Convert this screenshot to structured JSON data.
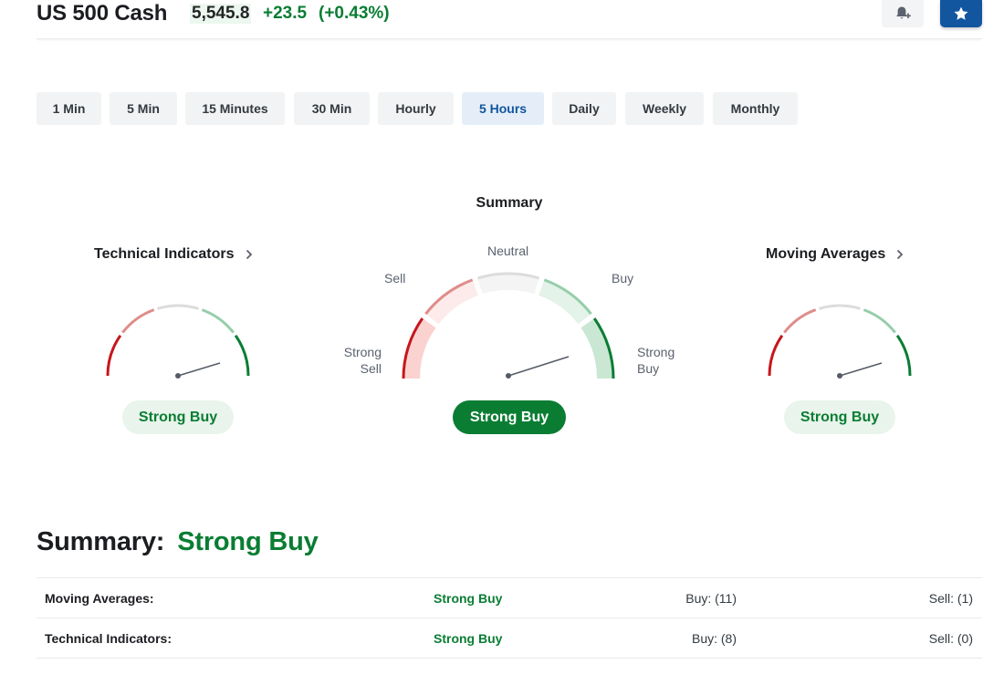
{
  "header": {
    "title": "US 500 Cash",
    "price": "5,545.8",
    "change": "+23.5",
    "change_pct": "(+0.43%)",
    "bell_icon": "bell-plus-icon",
    "star_icon": "star-icon"
  },
  "timeframes": [
    {
      "label": "1 Min",
      "active": false
    },
    {
      "label": "5 Min",
      "active": false
    },
    {
      "label": "15 Minutes",
      "active": false
    },
    {
      "label": "30 Min",
      "active": false
    },
    {
      "label": "Hourly",
      "active": false
    },
    {
      "label": "5 Hours",
      "active": true
    },
    {
      "label": "Daily",
      "active": false
    },
    {
      "label": "Weekly",
      "active": false
    },
    {
      "label": "Monthly",
      "active": false
    }
  ],
  "gauges": {
    "summary": {
      "title": "Summary",
      "labels": {
        "neutral": "Neutral",
        "sell": "Sell",
        "buy": "Buy",
        "strong_sell_1": "Strong",
        "strong_sell_2": "Sell",
        "strong_buy_1": "Strong",
        "strong_buy_2": "Buy"
      },
      "result": "Strong Buy"
    },
    "technical": {
      "title": "Technical Indicators",
      "result": "Strong Buy"
    },
    "moving": {
      "title": "Moving Averages",
      "result": "Strong Buy"
    }
  },
  "colors": {
    "strong_sell": "#c7161c",
    "sell": "#de8d8a",
    "neutral": "#dcdcdc",
    "buy": "#96ceaa",
    "strong_buy": "#0a7d33",
    "accent": "#1256a0"
  },
  "summary_section": {
    "label": "Summary:",
    "value": "Strong Buy",
    "rows": [
      {
        "name": "Moving Averages:",
        "signal": "Strong Buy",
        "buy": "Buy: (11)",
        "sell": "Sell: (1)"
      },
      {
        "name": "Technical Indicators:",
        "signal": "Strong Buy",
        "buy": "Buy: (8)",
        "sell": "Sell: (0)"
      }
    ]
  }
}
